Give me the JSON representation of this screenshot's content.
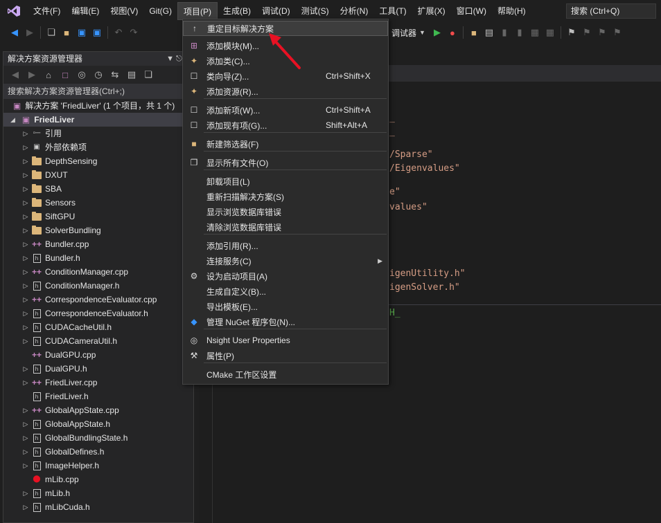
{
  "menubar": {
    "items": [
      "文件(F)",
      "编辑(E)",
      "视图(V)",
      "Git(G)",
      "项目(P)",
      "生成(B)",
      "调试(D)",
      "测试(S)",
      "分析(N)",
      "工具(T)",
      "扩展(X)",
      "窗口(W)",
      "帮助(H)"
    ],
    "search_label": "搜索 (Ctrl+Q)"
  },
  "toolbar": {
    "debugger_label": "调试器"
  },
  "solution_explorer": {
    "title": "解决方案资源管理器",
    "search_placeholder": "搜索解决方案资源管理器(Ctrl+;)",
    "root_label": "解决方案 'FriedLiver' (1 个项目，共 1 个)",
    "project_label": "FriedLiver",
    "items": [
      {
        "label": "引用",
        "icon": "references-icon",
        "expandable": true
      },
      {
        "label": "外部依赖项",
        "icon": "external-deps-icon",
        "expandable": true
      },
      {
        "label": "DepthSensing",
        "icon": "folder-icon",
        "expandable": true
      },
      {
        "label": "DXUT",
        "icon": "folder-icon",
        "expandable": true
      },
      {
        "label": "SBA",
        "icon": "folder-icon",
        "expandable": true
      },
      {
        "label": "Sensors",
        "icon": "folder-icon",
        "expandable": true
      },
      {
        "label": "SiftGPU",
        "icon": "folder-icon",
        "expandable": true
      },
      {
        "label": "SolverBundling",
        "icon": "folder-icon",
        "expandable": true
      },
      {
        "label": "Bundler.cpp",
        "icon": "cpp-file-icon",
        "expandable": true
      },
      {
        "label": "Bundler.h",
        "icon": "header-file-icon",
        "expandable": true
      },
      {
        "label": "ConditionManager.cpp",
        "icon": "cpp-file-icon",
        "expandable": true
      },
      {
        "label": "ConditionManager.h",
        "icon": "header-file-icon",
        "expandable": true
      },
      {
        "label": "CorrespondenceEvaluator.cpp",
        "icon": "cpp-file-icon",
        "expandable": true
      },
      {
        "label": "CorrespondenceEvaluator.h",
        "icon": "header-file-icon",
        "expandable": true
      },
      {
        "label": "CUDACacheUtil.h",
        "icon": "header-file-icon",
        "expandable": true
      },
      {
        "label": "CUDACameraUtil.h",
        "icon": "header-file-icon",
        "expandable": true
      },
      {
        "label": "DualGPU.cpp",
        "icon": "cpp-file-icon",
        "expandable": false
      },
      {
        "label": "DualGPU.h",
        "icon": "header-file-icon",
        "expandable": true
      },
      {
        "label": "FriedLiver.cpp",
        "icon": "cpp-file-icon",
        "expandable": true
      },
      {
        "label": "FriedLiver.h",
        "icon": "header-file-icon",
        "expandable": false
      },
      {
        "label": "GlobalAppState.cpp",
        "icon": "cpp-file-icon",
        "expandable": true
      },
      {
        "label": "GlobalAppState.h",
        "icon": "header-file-icon",
        "expandable": true
      },
      {
        "label": "GlobalBundlingState.h",
        "icon": "header-file-icon",
        "expandable": true
      },
      {
        "label": "GlobalDefines.h",
        "icon": "header-file-icon",
        "expandable": true
      },
      {
        "label": "ImageHelper.h",
        "icon": "header-file-icon",
        "expandable": true
      },
      {
        "label": "mLib.cpp",
        "icon": "cpp-error-file-icon",
        "expandable": false
      },
      {
        "label": "mLib.h",
        "icon": "header-file-icon",
        "expandable": true
      },
      {
        "label": "mLibCuda.h",
        "icon": "header-file-icon",
        "expandable": true
      }
    ]
  },
  "editor": {
    "lines": [
      {
        "text": "_",
        "cls": "code-str",
        "row": 0
      },
      {
        "text": "_",
        "cls": "code-str",
        "row": 1
      },
      {
        "text": "/Sparse\"",
        "cls": "code-str",
        "row": 2
      },
      {
        "text": "/Eigenvalues\"",
        "cls": "code-str",
        "row": 3
      },
      {
        "text": "e\"",
        "cls": "code-str",
        "row": 4
      },
      {
        "text": "values\"",
        "cls": "code-str",
        "row": 5
      },
      {
        "text": "igenUtility.h\"",
        "cls": "code-str",
        "row": 6
      },
      {
        "text": "igenSolver.h\"",
        "cls": "code-str",
        "row": 7
      },
      {
        "text": "H_",
        "cls": "code-green",
        "row": 8
      }
    ]
  },
  "project_menu": {
    "items": [
      {
        "label": "重定目标解决方案",
        "shortcut": "",
        "icon": "retarget-icon",
        "highlight": true
      },
      {
        "label": "添加模块(M)...",
        "shortcut": "",
        "icon": "add-module-icon"
      },
      {
        "label": "添加类(C)...",
        "shortcut": "",
        "icon": "add-class-icon"
      },
      {
        "label": "类向导(Z)...",
        "shortcut": "Ctrl+Shift+X",
        "icon": "class-wizard-icon"
      },
      {
        "label": "添加资源(R)...",
        "shortcut": "",
        "icon": "add-resource-icon"
      },
      {
        "label": "添加新项(W)...",
        "shortcut": "Ctrl+Shift+A",
        "icon": "add-new-item-icon"
      },
      {
        "label": "添加现有项(G)...",
        "shortcut": "Shift+Alt+A",
        "icon": "add-existing-item-icon"
      },
      {
        "label": "新建筛选器(F)",
        "shortcut": "",
        "icon": "new-filter-icon"
      },
      {
        "label": "显示所有文件(O)",
        "shortcut": "",
        "icon": "show-all-files-icon"
      },
      {
        "label": "卸载项目(L)",
        "shortcut": "",
        "icon": ""
      },
      {
        "label": "重新扫描解决方案(S)",
        "shortcut": "",
        "icon": ""
      },
      {
        "label": "显示浏览数据库错误",
        "shortcut": "",
        "icon": ""
      },
      {
        "label": "清除浏览数据库错误",
        "shortcut": "",
        "icon": ""
      },
      {
        "label": "添加引用(R)...",
        "shortcut": "",
        "icon": ""
      },
      {
        "label": "连接服务(C)",
        "shortcut": "",
        "icon": "",
        "submenu": true
      },
      {
        "label": "设为启动项目(A)",
        "shortcut": "",
        "icon": "gear-icon"
      },
      {
        "label": "生成自定义(B)...",
        "shortcut": "",
        "icon": ""
      },
      {
        "label": "导出模板(E)...",
        "shortcut": "",
        "icon": ""
      },
      {
        "label": "管理 NuGet 程序包(N)...",
        "shortcut": "",
        "icon": "nuget-icon"
      },
      {
        "label": "Nsight User Properties",
        "shortcut": "",
        "icon": "globe-icon"
      },
      {
        "label": "属性(P)",
        "shortcut": "",
        "icon": "wrench-icon"
      },
      {
        "label": "CMake 工作区设置",
        "shortcut": "",
        "icon": ""
      }
    ]
  }
}
